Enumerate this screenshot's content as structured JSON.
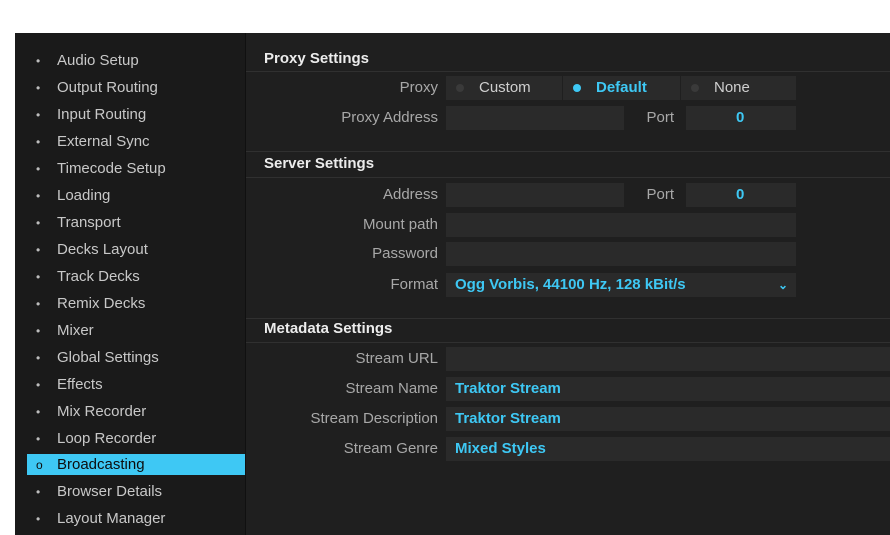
{
  "sidebar": {
    "items": [
      {
        "label": "Audio Setup"
      },
      {
        "label": "Output Routing"
      },
      {
        "label": "Input Routing"
      },
      {
        "label": "External Sync"
      },
      {
        "label": "Timecode Setup"
      },
      {
        "label": "Loading"
      },
      {
        "label": "Transport"
      },
      {
        "label": "Decks Layout"
      },
      {
        "label": "Track Decks"
      },
      {
        "label": "Remix Decks"
      },
      {
        "label": "Mixer"
      },
      {
        "label": "Global Settings"
      },
      {
        "label": "Effects"
      },
      {
        "label": "Mix Recorder"
      },
      {
        "label": "Loop Recorder"
      },
      {
        "label": "Broadcasting"
      },
      {
        "label": "Browser Details"
      },
      {
        "label": "Layout Manager"
      }
    ],
    "active": "Broadcasting",
    "bullet": "•",
    "active_bullet": "o"
  },
  "proxy": {
    "title": "Proxy Settings",
    "proxy_label": "Proxy",
    "options": [
      "Custom",
      "Default",
      "None"
    ],
    "selected": "Default",
    "address_label": "Proxy Address",
    "address_value": "",
    "port_label": "Port",
    "port_value": "0"
  },
  "server": {
    "title": "Server Settings",
    "address_label": "Address",
    "address_value": "",
    "port_label": "Port",
    "port_value": "0",
    "mount_label": "Mount path",
    "mount_value": "",
    "password_label": "Password",
    "password_value": "",
    "format_label": "Format",
    "format_value": "Ogg Vorbis, 44100 Hz, 128 kBit/s",
    "format_icon": "chevron-down-icon"
  },
  "metadata": {
    "title": "Metadata Settings",
    "url_label": "Stream URL",
    "url_value": "",
    "name_label": "Stream Name",
    "name_value": "Traktor Stream",
    "desc_label": "Stream Description",
    "desc_value": "Traktor Stream",
    "genre_label": "Stream Genre",
    "genre_value": "Mixed Styles"
  },
  "colors": {
    "accent": "#3ec8f4",
    "background": "#1f1f1f",
    "field": "#2a2a2a"
  }
}
